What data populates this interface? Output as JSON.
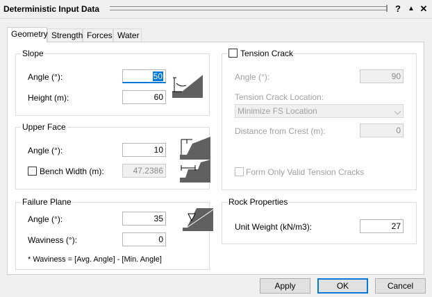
{
  "window": {
    "title": "Deterministic Input Data",
    "help_label": "?",
    "collapse_label": "▲",
    "close_label": "✕"
  },
  "tabs": [
    {
      "label": "Geometry",
      "active": true
    },
    {
      "label": "Strength",
      "active": false
    },
    {
      "label": "Forces",
      "active": false
    },
    {
      "label": "Water",
      "active": false
    }
  ],
  "slope": {
    "title": "Slope",
    "angle_label": "Angle (°):",
    "angle_value": "50",
    "height_label": "Height (m):",
    "height_value": "60"
  },
  "upper_face": {
    "title": "Upper Face",
    "angle_label": "Angle (°):",
    "angle_value": "10",
    "bench_label": "Bench Width (m):",
    "bench_value": "47.2386",
    "bench_checked": false
  },
  "failure_plane": {
    "title": "Failure Plane",
    "angle_label": "Angle (°):",
    "angle_value": "35",
    "waviness_label": "Waviness (°):",
    "waviness_value": "0",
    "note": "* Waviness = [Avg. Angle] - [Min. Angle]"
  },
  "tension_crack": {
    "title": "Tension Crack",
    "checked": false,
    "angle_label": "Angle (°):",
    "angle_value": "90",
    "location_label": "Tension Crack Location:",
    "location_value": "Minimize FS Location",
    "distance_label": "Distance from Crest (m):",
    "distance_value": "0",
    "valid_label": "Form Only Valid Tension Cracks",
    "valid_checked": false
  },
  "rock_properties": {
    "title": "Rock Properties",
    "unit_weight_label": "Unit Weight (kN/m3):",
    "unit_weight_value": "27"
  },
  "buttons": {
    "apply": "Apply",
    "ok": "OK",
    "cancel": "Cancel"
  },
  "colors": {
    "accent": "#0078d7",
    "slope_fill": "#606060"
  }
}
